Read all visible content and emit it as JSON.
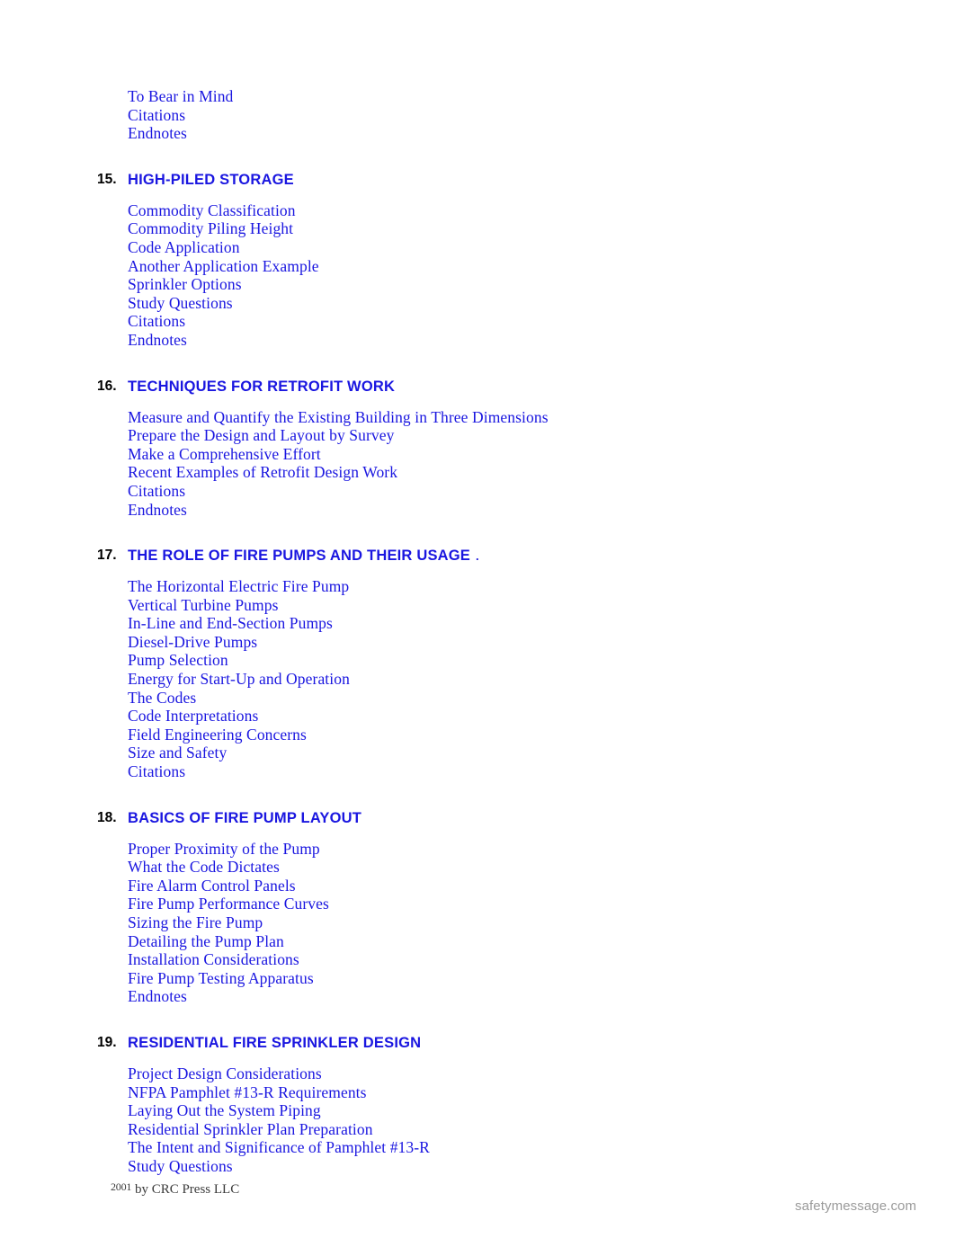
{
  "document": {
    "type": "table-of-contents",
    "colors": {
      "link_blue": "#1a16e0",
      "number_black": "#000000",
      "footer_gray": "#3b3b3b",
      "watermark_gray": "#9a9a9a",
      "page_background": "#ffffff"
    }
  },
  "continued_entries": [
    "To Bear in Mind",
    "Citations",
    "Endnotes"
  ],
  "chapters": [
    {
      "number": "15.",
      "title": "HIGH-PILED STORAGE",
      "title_trailer": "",
      "entries": [
        "Commodity Classification",
        "Commodity Piling Height",
        "Code Application",
        "Another Application Example",
        "Sprinkler Options",
        "Study Questions",
        "Citations",
        "Endnotes"
      ]
    },
    {
      "number": "16.",
      "title": "TECHNIQUES FOR RETROFIT WORK",
      "title_trailer": "",
      "entries": [
        "Measure and Quantify the Existing Building in Three Dimensions",
        "Prepare the Design and Layout by Survey",
        "Make a Comprehensive Effort",
        "Recent Examples of Retrofit Design Work",
        "Citations",
        "Endnotes"
      ]
    },
    {
      "number": "17.",
      "title": "THE ROLE OF FIRE PUMPS AND THEIR USAGE",
      "title_trailer": ".",
      "entries": [
        "The Horizontal Electric Fire Pump",
        "Vertical Turbine Pumps",
        "In-Line and End-Section Pumps",
        "Diesel-Drive Pumps",
        "Pump Selection",
        "Energy for Start-Up and Operation",
        "The Codes",
        "Code Interpretations",
        "Field Engineering Concerns",
        "Size and Safety",
        "Citations"
      ]
    },
    {
      "number": "18.",
      "title": "BASICS OF FIRE PUMP LAYOUT",
      "title_trailer": "",
      "entries": [
        "Proper Proximity of the Pump",
        "What the Code Dictates",
        "Fire Alarm Control Panels",
        "Fire Pump Performance Curves",
        "Sizing the Fire Pump",
        "Detailing the Pump Plan",
        "Installation Considerations",
        "Fire Pump Testing Apparatus",
        "Endnotes"
      ]
    },
    {
      "number": "19.",
      "title": "RESIDENTIAL FIRE SPRINKLER DESIGN",
      "title_trailer": "",
      "entries": [
        "Project Design Considerations",
        "NFPA Pamphlet #13-R Requirements",
        "Laying Out the System Piping",
        "Residential Sprinkler Plan Preparation",
        "The Intent and Significance of Pamphlet #13-R",
        "Study Questions"
      ]
    }
  ],
  "footer": {
    "year": "2001",
    "publisher": "by CRC Press LLC"
  },
  "watermark": {
    "text": "safetymessage.com"
  }
}
